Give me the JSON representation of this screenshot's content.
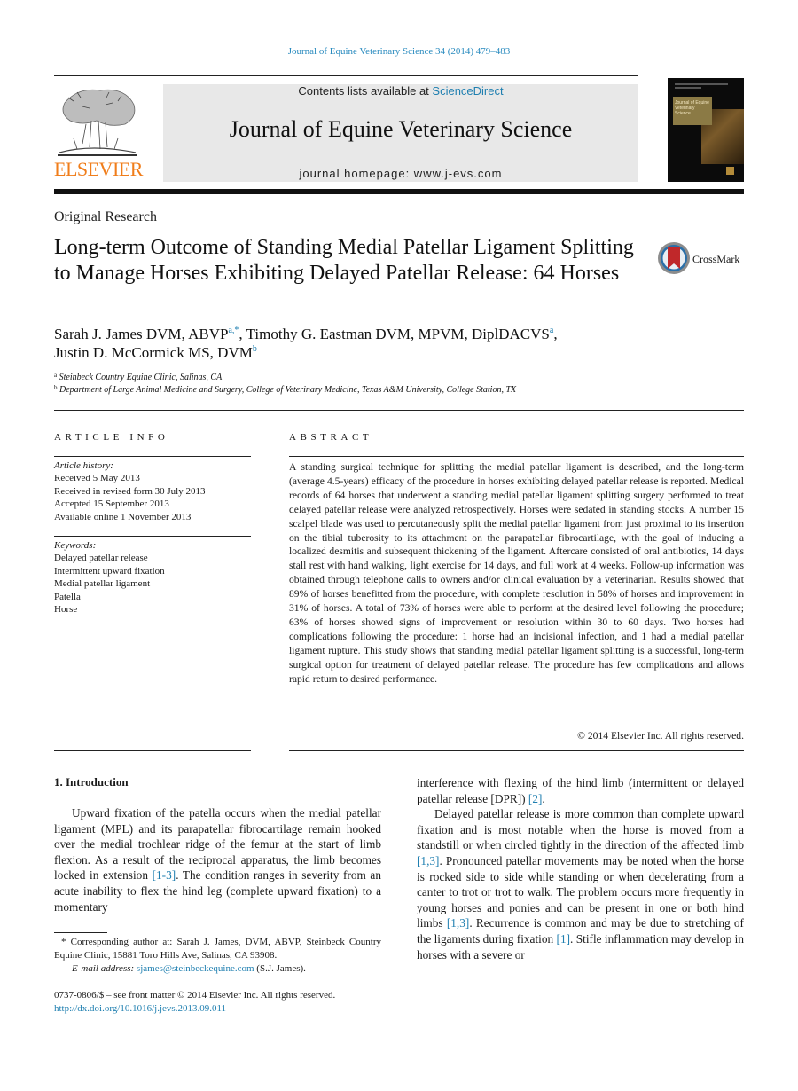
{
  "header": {
    "citation": "Journal of Equine Veterinary Science 34 (2014) 479–483",
    "publisher_logo_text": "ELSEVIER",
    "contents_prefix": "Contents lists available at ",
    "contents_link": "ScienceDirect",
    "journal_title": "Journal of Equine Veterinary Science",
    "homepage": "journal homepage: www.j-evs.com",
    "cover_title": "Journal of Equine Veterinary Science"
  },
  "article": {
    "type": "Original Research",
    "title": "Long-term Outcome of Standing Medial Patellar Ligament Splitting to Manage Horses Exhibiting Delayed Patellar Release: 64 Horses",
    "crossmark_label": "CrossMark",
    "authors": [
      {
        "name": "Sarah J. James DVM, ABVP",
        "sup": "a,*",
        "sep": ", "
      },
      {
        "name": "Timothy G. Eastman DVM, MPVM, DiplDACVS",
        "sup": "a",
        "sep": ","
      },
      {
        "name": "Justin D. McCormick MS, DVM",
        "sup": "b",
        "sep": ""
      }
    ],
    "affiliations": [
      {
        "key": "a",
        "text": "Steinbeck Country Equine Clinic, Salinas, CA"
      },
      {
        "key": "b",
        "text": "Department of Large Animal Medicine and Surgery, College of Veterinary Medicine, Texas A&M University, College Station, TX"
      }
    ]
  },
  "article_info": {
    "heading": "ARTICLE INFO",
    "history_label": "Article history:",
    "history": [
      "Received 5 May 2013",
      "Received in revised form 30 July 2013",
      "Accepted 15 September 2013",
      "Available online 1 November 2013"
    ],
    "keywords_label": "Keywords:",
    "keywords": [
      "Delayed patellar release",
      "Intermittent upward fixation",
      "Medial patellar ligament",
      "Patella",
      "Horse"
    ]
  },
  "abstract": {
    "heading": "ABSTRACT",
    "text": "A standing surgical technique for splitting the medial patellar ligament is described, and the long-term (average 4.5-years) efficacy of the procedure in horses exhibiting delayed patellar release is reported. Medical records of 64 horses that underwent a standing medial patellar ligament splitting surgery performed to treat delayed patellar release were analyzed retrospectively. Horses were sedated in standing stocks. A number 15 scalpel blade was used to percutaneously split the medial patellar ligament from just proximal to its insertion on the tibial tuberosity to its attachment on the parapatellar fibrocartilage, with the goal of inducing a localized desmitis and subsequent thickening of the ligament. Aftercare consisted of oral antibiotics, 14 days stall rest with hand walking, light exercise for 14 days, and full work at 4 weeks. Follow-up information was obtained through tele­phone calls to owners and/or clinical evaluation by a veterinarian. Results showed that 89% of horses benefitted from the procedure, with complete resolution in 58% of horses and improvement in 31% of horses. A total of 73% of horses were able to perform at the desired level following the procedure; 63% of horses showed signs of improvement or resolution within 30 to 60 days. Two horses had complications following the procedure: 1 horse had an incisional infection, and 1 had a medial patellar ligament rupture. This study shows that standing medial patellar ligament splitting is a successful, long-term surgical option for treatment of delayed patellar release. The procedure has few compli­cations and allows rapid return to desired performance.",
    "copyright": "© 2014 Elsevier Inc. All rights reserved."
  },
  "body": {
    "section_heading": "1.  Introduction",
    "left_p1_a": "Upward fixation of the patella occurs when the medial patellar ligament (MPL) and its parapatellar fibrocartilage remain hooked over the medial trochlear ridge of the femur at the start of limb flexion. As a result of the reciprocal apparatus, the limb becomes locked in extension ",
    "left_p1_ref": "[1-3]",
    "left_p1_b": ". The condition ranges in severity from an acute inability to flex the hind leg (complete upward fixation) to a momentary",
    "right_p1_a": "interference with flexing of the hind limb (intermittent or delayed patellar release [DPR]) ",
    "right_p1_ref": "[2]",
    "right_p1_b": ".",
    "right_p2_a": "Delayed patellar release is more common than complete upward fixation and is most notable when the horse is moved from a standstill or when circled tightly in the direction of the affected limb ",
    "right_p2_ref1": "[1,3]",
    "right_p2_b": ". Pronounced patellar movements may be noted when the horse is rocked side to side while standing or when decelerating from a canter to trot or trot to walk. The problem occurs more frequently in young horses and ponies and can be present in one or both hind limbs ",
    "right_p2_ref2": "[1,3]",
    "right_p2_c": ". Recurrence is common and may be due to stretching of the ligaments during fixation ",
    "right_p2_ref3": "[1]",
    "right_p2_d": ". Stifle inflammation may develop in horses with a severe or"
  },
  "footnote": {
    "corresponding": "* Corresponding author at: Sarah J. James, DVM, ABVP, Steinbeck Country Equine Clinic, 15881 Toro Hills Ave, Salinas, CA 93908.",
    "email_label": "E-mail address:",
    "email": "sjames@steinbeckequine.com",
    "email_suffix": " (S.J. James).",
    "front_matter": "0737-0806/$ – see front matter © 2014 Elsevier Inc. All rights reserved.",
    "doi": "http://dx.doi.org/10.1016/j.jevs.2013.09.011"
  },
  "colors": {
    "link": "#1f7fb0",
    "elsevier_orange": "#f07d1a",
    "banner_bg": "#e8e8e8"
  }
}
